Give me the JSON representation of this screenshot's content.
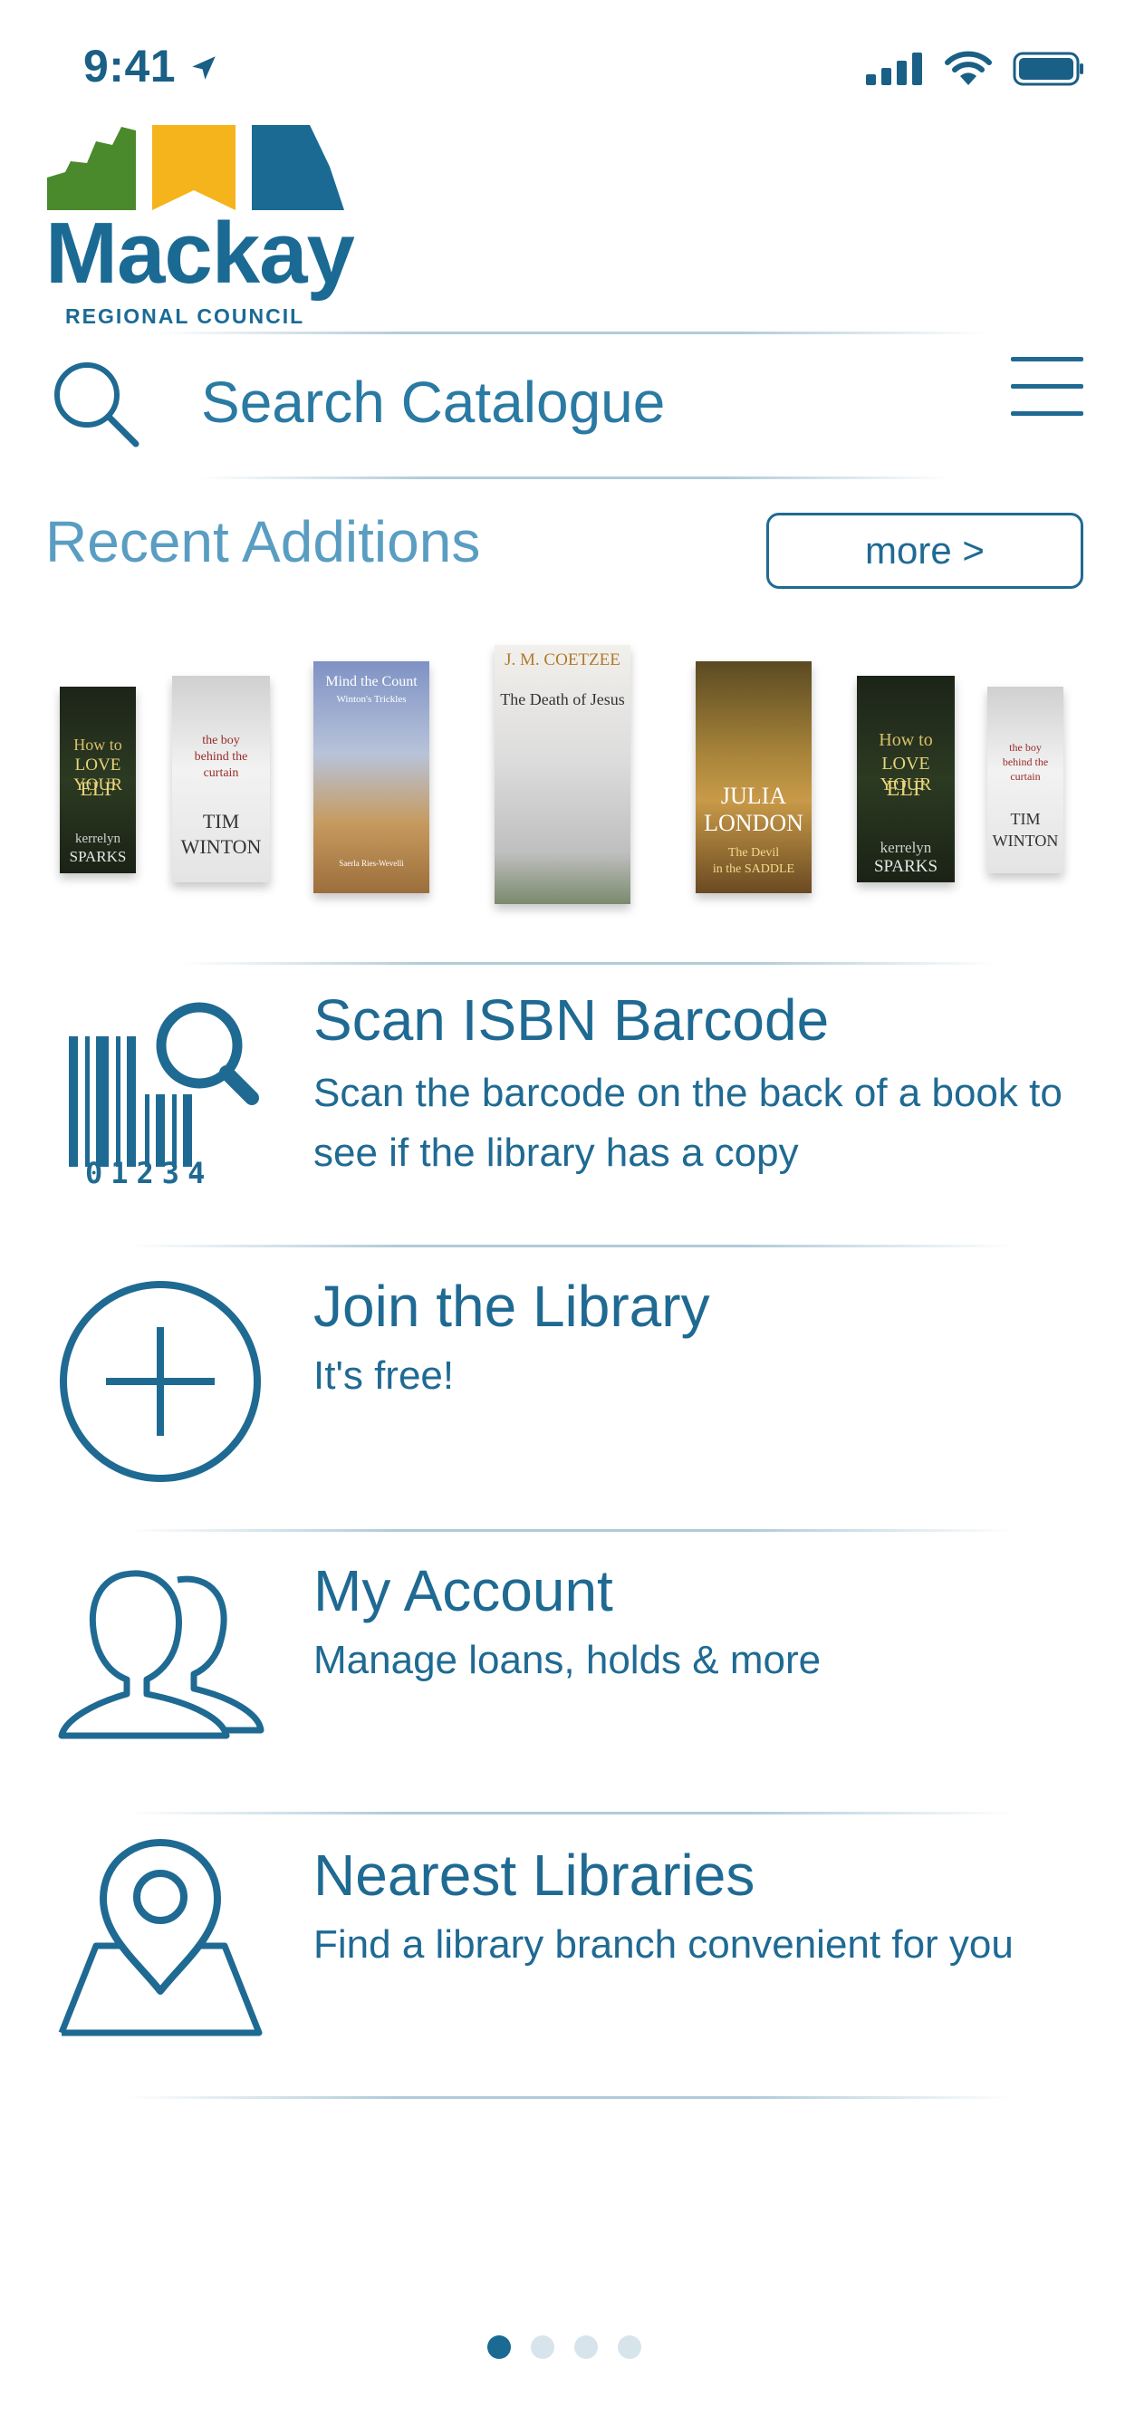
{
  "status_bar": {
    "time": "9:41"
  },
  "logo": {
    "wordmark": "Mackay",
    "subtitle": "REGIONAL COUNCIL"
  },
  "search": {
    "label": "Search Catalogue"
  },
  "recent": {
    "title": "Recent Additions",
    "more_label": "more >",
    "books": [
      {
        "lines": [
          "How to",
          "LOVE YOUR",
          "ELF",
          "kerrelyn",
          "SPARKS"
        ]
      },
      {
        "lines": [
          "the boy",
          "behind the",
          "curtain",
          "TIM",
          "WINTON"
        ]
      },
      {
        "lines": [
          "Mind the Count",
          "Winton's Trickles",
          "Saerla Ries-Wevelli"
        ]
      },
      {
        "lines": [
          "J. M. COETZEE",
          "The Death of Jesus"
        ]
      },
      {
        "lines": [
          "JULIA",
          "LONDON",
          "The Devil",
          "in the SADDLE"
        ]
      },
      {
        "lines": [
          "How to",
          "LOVE YOUR",
          "ELF",
          "kerrelyn",
          "SPARKS"
        ]
      },
      {
        "lines": [
          "the boy",
          "behind the",
          "curtain",
          "TIM",
          "WINTON"
        ]
      }
    ]
  },
  "menu": [
    {
      "icon": "barcode-search-icon",
      "title": "Scan ISBN Barcode",
      "desc": "Scan the barcode on the back of a book to see if the library has a copy",
      "barcode_digits": "01234"
    },
    {
      "icon": "plus-circle-icon",
      "title": "Join the Library",
      "desc": "It's free!"
    },
    {
      "icon": "users-icon",
      "title": "My Account",
      "desc": "Manage loans, holds & more"
    },
    {
      "icon": "location-pin-icon",
      "title": "Nearest Libraries",
      "desc": "Find a library branch convenient for you"
    }
  ],
  "pagination": {
    "count": 4,
    "active": 0
  },
  "colors": {
    "primary": "#1f6a93",
    "logo_green": "#4a8a2c",
    "logo_yellow": "#f5b41c",
    "logo_blue": "#1a6a94"
  }
}
